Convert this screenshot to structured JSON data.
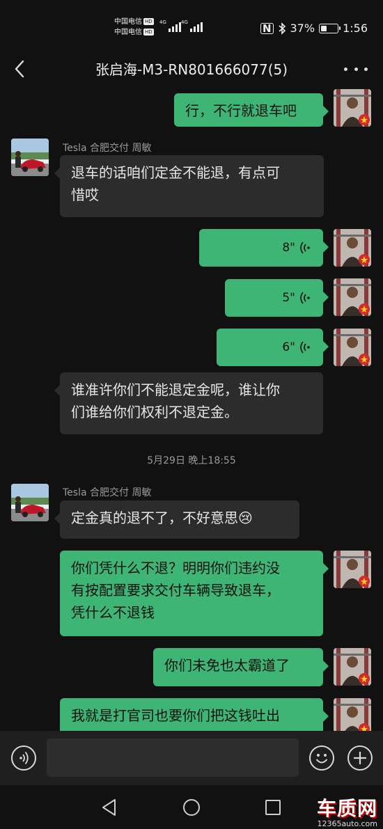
{
  "status_bar": {
    "carrier_1": "中国电信",
    "carrier_2": "中国电信",
    "hd_badge": "HD",
    "network_1": "4G",
    "network_2": "4G",
    "battery_percent": "37%",
    "battery_level": 0.37,
    "time": "1:56",
    "icons": [
      "nfc-icon",
      "bluetooth-icon",
      "battery-icon",
      "signal-icon"
    ]
  },
  "header": {
    "title": "张启海-M3-RN801666077(5)",
    "icons": [
      "back-arrow-icon",
      "more-options-icon"
    ]
  },
  "messages": [
    {
      "side": "right",
      "type": "text",
      "text": "行，不行就退车吧"
    },
    {
      "side": "left",
      "sender": "Tesla 合肥交付 周敏",
      "type": "text",
      "lines": [
        "退车的话咱们定金不能退，有点可",
        "惜哎"
      ]
    },
    {
      "side": "right",
      "type": "voice",
      "duration": "8\""
    },
    {
      "side": "right",
      "type": "voice",
      "duration": "5\""
    },
    {
      "side": "right",
      "type": "voice",
      "duration": "6\""
    },
    {
      "side": "left",
      "type": "text",
      "lines": [
        "谁准许你们不能退定金呢，谁让你",
        "们谁给你们权利不退定金。"
      ]
    },
    {
      "type": "timestamp",
      "text": "5月29日 晚上18:55"
    },
    {
      "side": "left",
      "sender": "Tesla 合肥交付 周敏",
      "type": "text",
      "text": "定金真的退不了，不好意思😢"
    },
    {
      "side": "right",
      "type": "text",
      "lines": [
        "你们凭什么不退？明明你们违约没",
        "有按配置要求交付车辆导致退车，",
        "凭什么不退钱"
      ]
    },
    {
      "side": "right",
      "type": "text",
      "text": "你们未免也太霸道了"
    },
    {
      "side": "right",
      "type": "text",
      "text": "我就是打官司也要你们把这钱吐出"
    }
  ],
  "input_bar": {
    "placeholder": "",
    "icons": [
      "voice-input-icon",
      "emoji-icon",
      "plus-icon"
    ]
  },
  "nav_bar": {
    "icons": [
      "nav-back-icon",
      "nav-home-icon",
      "nav-recents-icon"
    ]
  },
  "watermark": {
    "logo_text": "车质网",
    "url": "12365auto.com"
  },
  "colors": {
    "background": "#111111",
    "outgoing_bubble": "#3eb575",
    "incoming_bubble": "#2c2c2c",
    "meta_text": "#9a9a9a"
  }
}
